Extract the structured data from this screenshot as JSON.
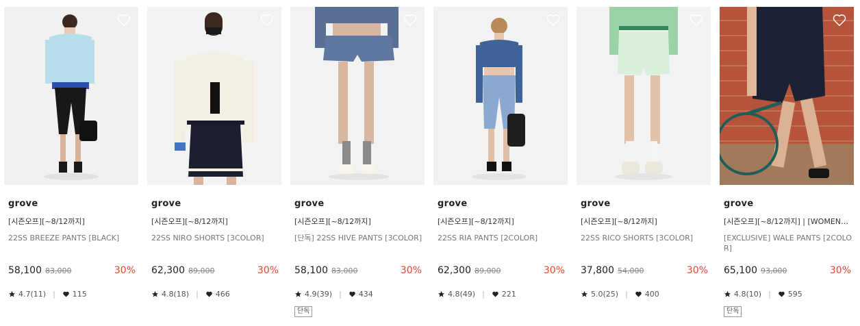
{
  "colors": {
    "discount": "#e8452c",
    "text": "#222222",
    "muted": "#777777"
  },
  "products": [
    {
      "brand": "grove",
      "promo": "[시즌오프][~8/12까지]",
      "name": "22SS BREEZE PANTS [BLACK]",
      "price": "58,100",
      "original_price": "83,000",
      "discount": "30%",
      "rating": "4.7(11)",
      "likes": "115",
      "badge": null
    },
    {
      "brand": "grove",
      "promo": "[시즌오프][~8/12까지]",
      "name": "22SS NIRO SHORTS [3COLOR]",
      "price": "62,300",
      "original_price": "89,000",
      "discount": "30%",
      "rating": "4.8(18)",
      "likes": "466",
      "badge": null
    },
    {
      "brand": "grove",
      "promo": "[시즌오프][~8/12까지]",
      "name": "[단독] 22SS HIVE PANTS [3COLOR]",
      "price": "58,100",
      "original_price": "83,000",
      "discount": "30%",
      "rating": "4.9(39)",
      "likes": "434",
      "badge": "단독"
    },
    {
      "brand": "grove",
      "promo": "[시즌오프][~8/12까지]",
      "name": "22SS RIA PANTS [2COLOR]",
      "price": "62,300",
      "original_price": "89,000",
      "discount": "30%",
      "rating": "4.8(49)",
      "likes": "221",
      "badge": null
    },
    {
      "brand": "grove",
      "promo": "[시즌오프][~8/12까지]",
      "name": "22SS RICO SHORTS [3COLOR]",
      "price": "37,800",
      "original_price": "54,000",
      "discount": "30%",
      "rating": "5.0(25)",
      "likes": "400",
      "badge": null
    },
    {
      "brand": "grove",
      "promo": "[시즌오프][~8/12까지] | [WOMEN…",
      "name": "[EXCLUSIVE] WALE PANTS [2COLOR]",
      "price": "65,100",
      "original_price": "93,000",
      "discount": "30%",
      "rating": "4.8(10)",
      "likes": "595",
      "badge": "단독"
    }
  ]
}
